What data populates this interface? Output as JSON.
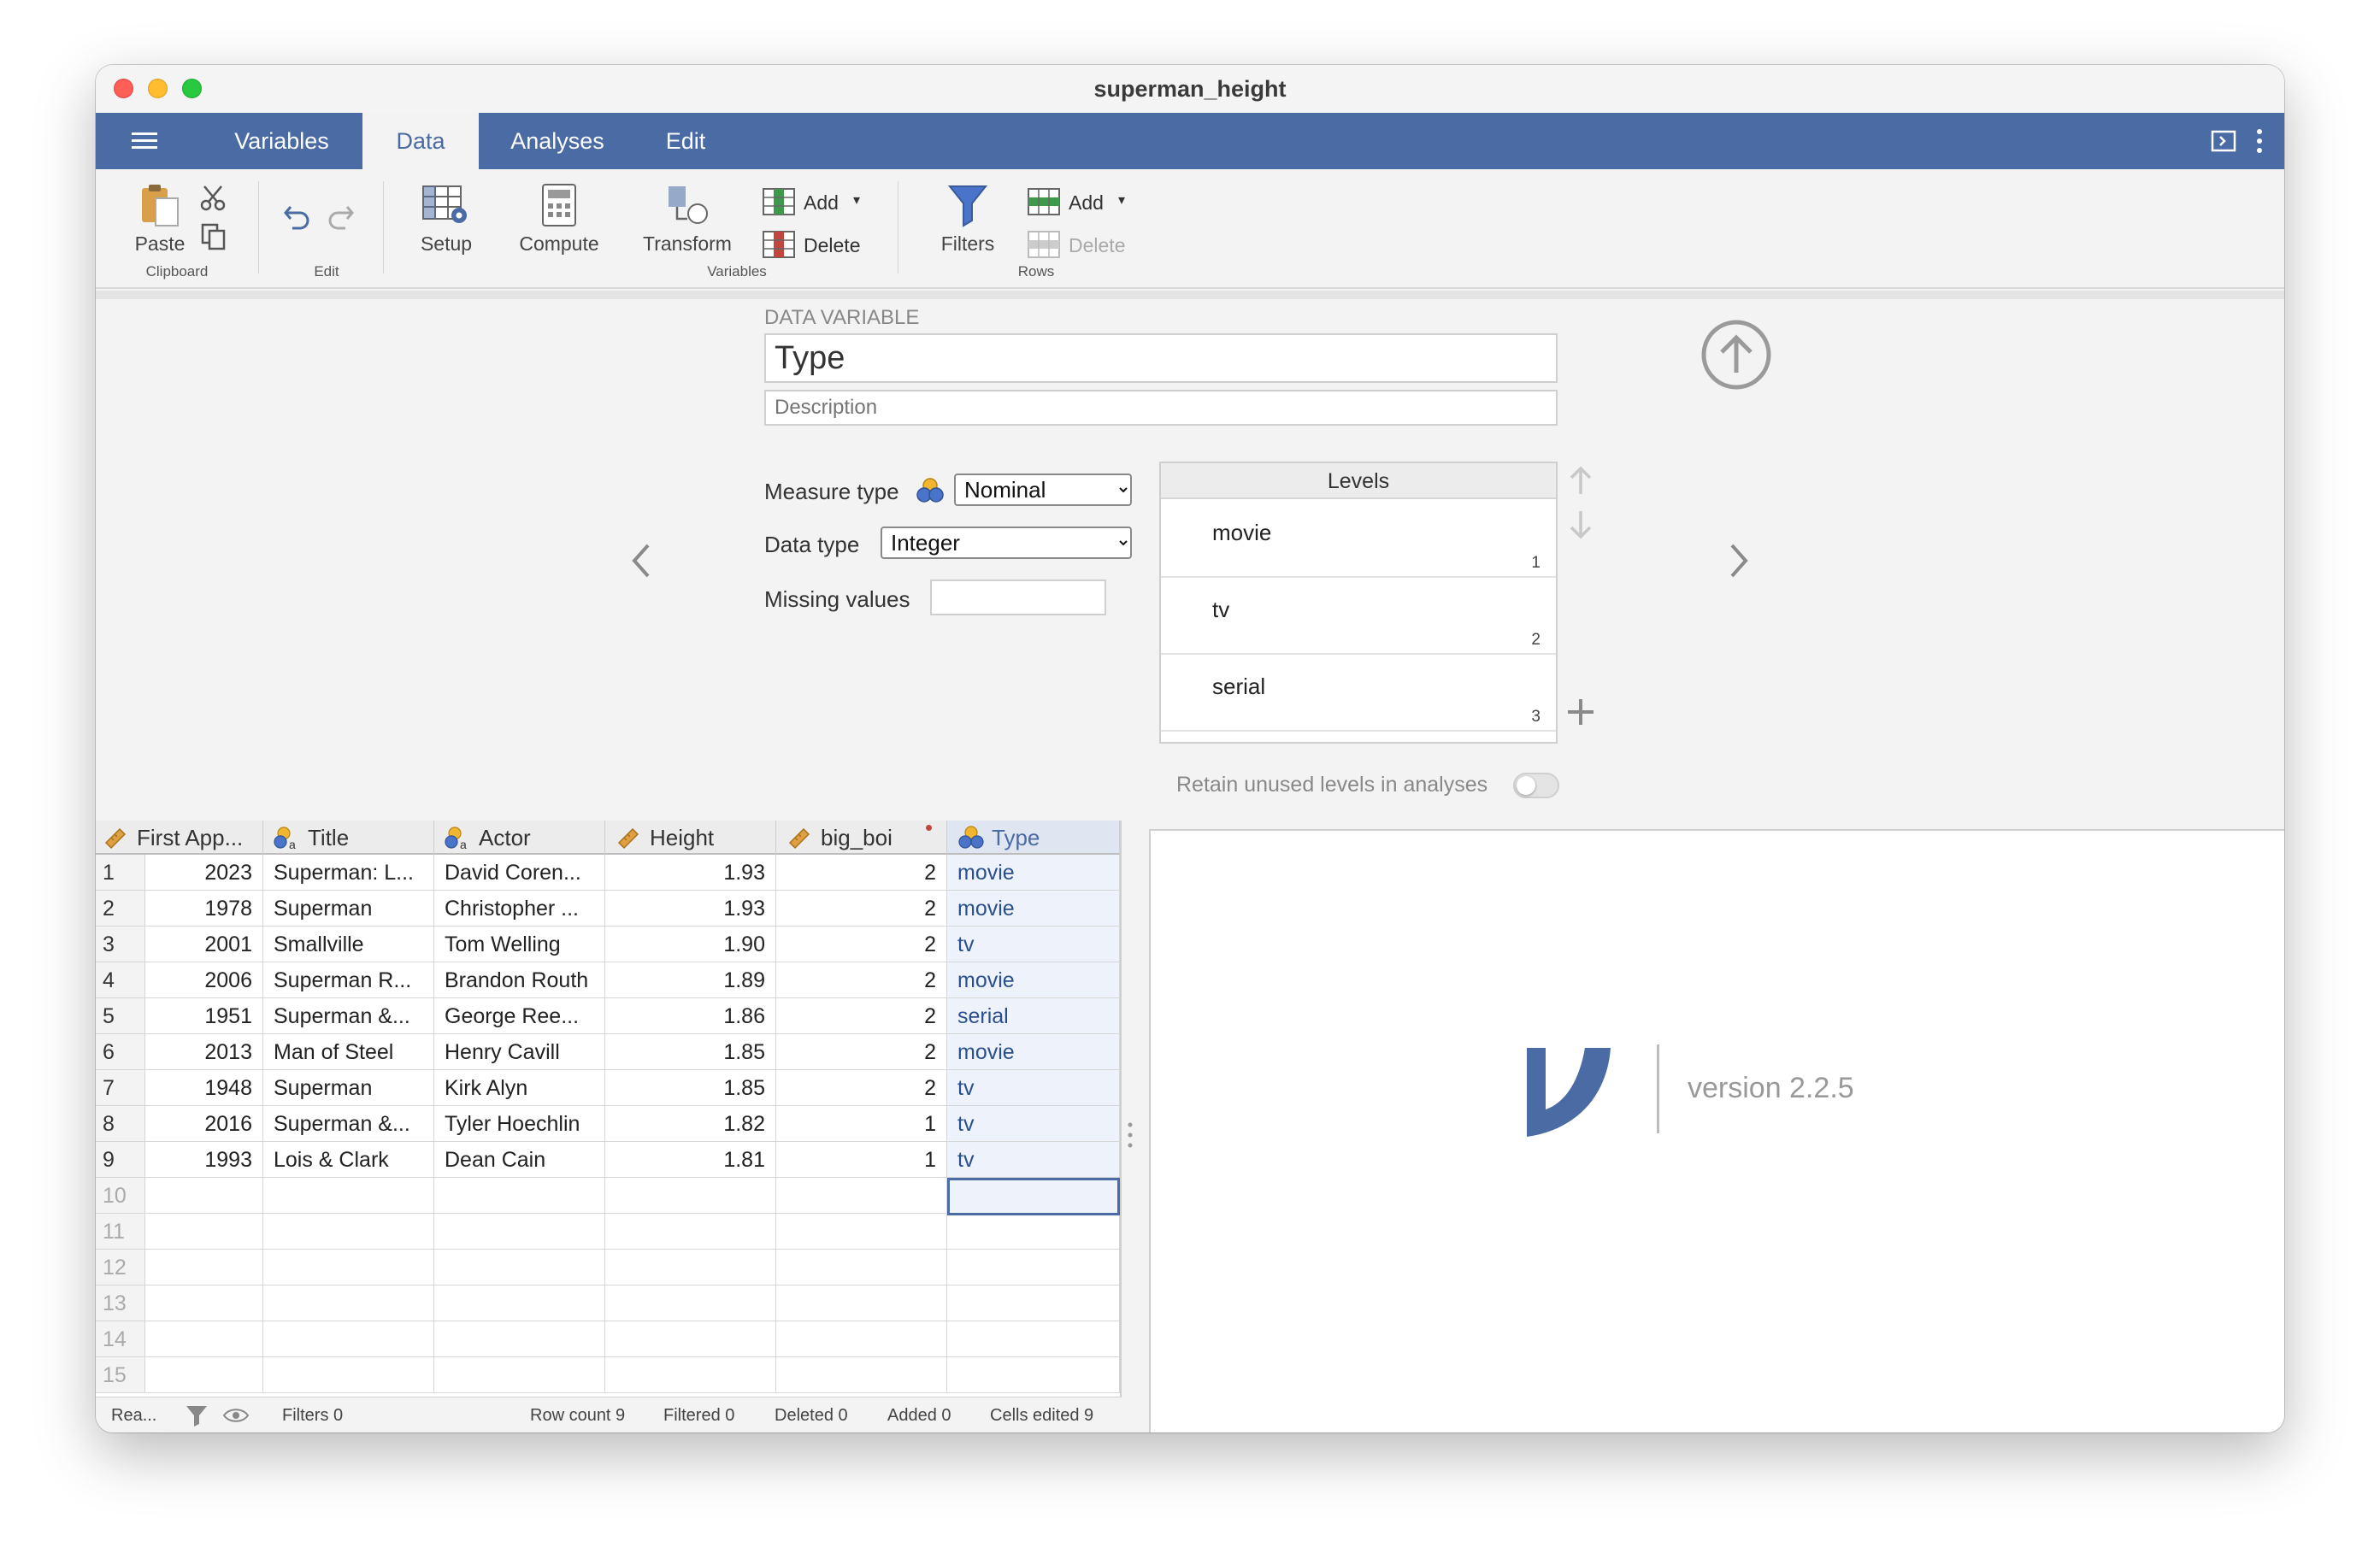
{
  "window": {
    "title": "superman_height"
  },
  "tabs": [
    "Variables",
    "Data",
    "Analyses",
    "Edit"
  ],
  "ribbon": {
    "paste": "Paste",
    "clipboard_group": "Clipboard",
    "edit_group": "Edit",
    "setup": "Setup",
    "compute": "Compute",
    "transform": "Transform",
    "variables_group": "Variables",
    "add_var": "Add",
    "delete_var": "Delete",
    "filters": "Filters",
    "add_row": "Add",
    "delete_row": "Delete",
    "rows_group": "Rows"
  },
  "editor": {
    "section_label": "DATA VARIABLE",
    "name": "Type",
    "description_placeholder": "Description",
    "measure_type_label": "Measure type",
    "measure_type_value": "Nominal",
    "data_type_label": "Data type",
    "data_type_value": "Integer",
    "missing_values_label": "Missing values",
    "levels_header": "Levels",
    "levels": [
      {
        "label": "movie",
        "value": "1"
      },
      {
        "label": "tv",
        "value": "2"
      },
      {
        "label": "serial",
        "value": "3"
      }
    ],
    "retain_label": "Retain unused levels in analyses"
  },
  "grid": {
    "columns": [
      "First App...",
      "Title",
      "Actor",
      "Height",
      "big_boi",
      "Type"
    ],
    "rows": [
      {
        "n": "1",
        "year": "2023",
        "title": "Superman: L...",
        "actor": "David Coren...",
        "height": "1.93",
        "big": "2",
        "type": "movie"
      },
      {
        "n": "2",
        "year": "1978",
        "title": "Superman",
        "actor": "Christopher ...",
        "height": "1.93",
        "big": "2",
        "type": "movie"
      },
      {
        "n": "3",
        "year": "2001",
        "title": "Smallville",
        "actor": "Tom Welling",
        "height": "1.90",
        "big": "2",
        "type": "tv"
      },
      {
        "n": "4",
        "year": "2006",
        "title": "Superman R...",
        "actor": "Brandon Routh",
        "height": "1.89",
        "big": "2",
        "type": "movie"
      },
      {
        "n": "5",
        "year": "1951",
        "title": "Superman &...",
        "actor": "George Ree...",
        "height": "1.86",
        "big": "2",
        "type": "serial"
      },
      {
        "n": "6",
        "year": "2013",
        "title": "Man of Steel",
        "actor": "Henry Cavill",
        "height": "1.85",
        "big": "2",
        "type": "movie"
      },
      {
        "n": "7",
        "year": "1948",
        "title": "Superman",
        "actor": "Kirk Alyn",
        "height": "1.85",
        "big": "2",
        "type": "tv"
      },
      {
        "n": "8",
        "year": "2016",
        "title": "Superman &...",
        "actor": "Tyler Hoechlin",
        "height": "1.82",
        "big": "1",
        "type": "tv"
      },
      {
        "n": "9",
        "year": "1993",
        "title": "Lois & Clark",
        "actor": "Dean Cain",
        "height": "1.81",
        "big": "1",
        "type": "tv"
      }
    ],
    "empty_rows": [
      "10",
      "11",
      "12",
      "13",
      "14",
      "15"
    ]
  },
  "status": {
    "ready": "Rea...",
    "filters": "Filters 0",
    "row_count": "Row count 9",
    "filtered": "Filtered 0",
    "deleted": "Deleted 0",
    "added": "Added 0",
    "cells_edited": "Cells edited 9"
  },
  "results": {
    "version": "version 2.2.5"
  },
  "colors": {
    "brand": "#4a6ba4",
    "ruler": "#e0a042",
    "nominal_blue": "#4a74c9",
    "nominal_yellow": "#f0b632"
  }
}
